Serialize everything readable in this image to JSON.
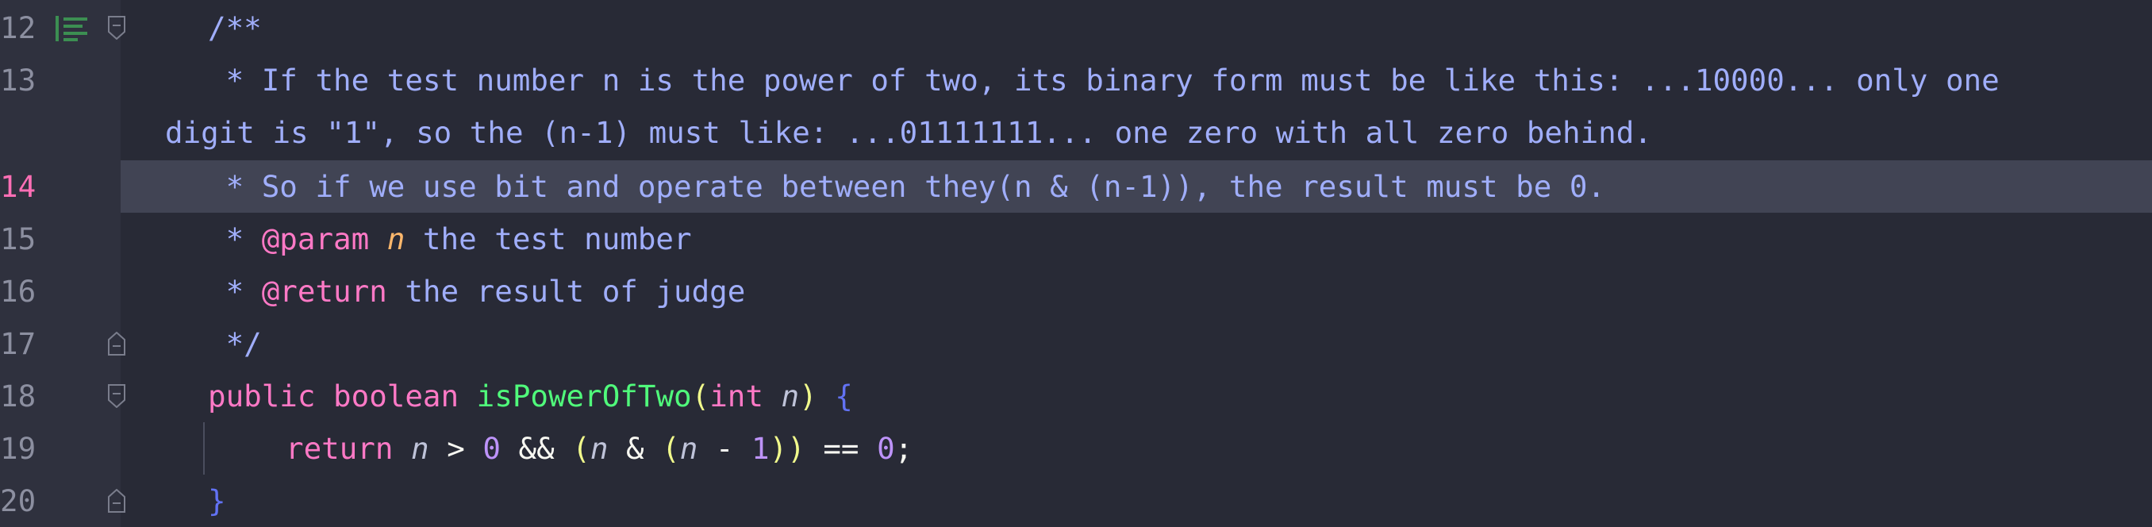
{
  "editor": {
    "lines": [
      {
        "num": "12",
        "text": "/**"
      },
      {
        "num": "13",
        "text": " * If the test number n is the power of two, its binary form must be like this: ...10000... only one",
        "wrap": "digit is \"1\", so the (n-1) must like: ...01111111... one zero with all zero behind."
      },
      {
        "num": "14",
        "text": " * So if we use bit and operate between they(n & (n-1)), the result must be 0."
      },
      {
        "num": "15",
        "prefix": " * ",
        "tag": "@param",
        "param": "n",
        "rest": " the test number"
      },
      {
        "num": "16",
        "prefix": " * ",
        "tag": "@return",
        "rest": " the result of judge"
      },
      {
        "num": "17",
        "text": " */"
      },
      {
        "num": "18",
        "kw1": "public",
        "kw2": "boolean",
        "fn": "isPowerOfTwo",
        "open": "(",
        "kw3": "int",
        "param": "n",
        "close": ")",
        "brace": "{"
      },
      {
        "num": "19",
        "kw": "return",
        "v1": "n",
        "op1": ">",
        "n0": "0",
        "op2": "&&",
        "p1": "(",
        "v2": "n",
        "op3": "&",
        "p2": "(",
        "v3": "n",
        "op4": "-",
        "n1": "1",
        "p3": "))",
        "op5": "==",
        "n2": "0",
        "semi": ";"
      },
      {
        "num": "20",
        "brace": "}"
      }
    ]
  },
  "colors": {
    "background": "#282a36",
    "gutter": "#2f313e",
    "current_line": "#414454",
    "comment": "#a0aefb",
    "keyword": "#ff79c6",
    "function": "#50fa7b",
    "number": "#bd93f9"
  }
}
